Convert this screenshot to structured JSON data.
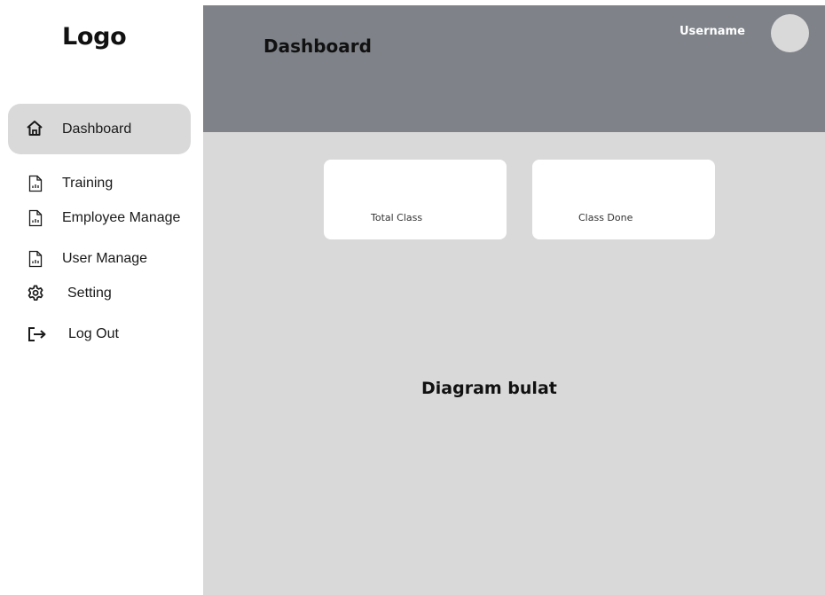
{
  "sidebar": {
    "logo": "Logo",
    "items": [
      {
        "label": "Dashboard",
        "icon": "home-icon",
        "active": true
      },
      {
        "label": "Training",
        "icon": "report-icon",
        "active": false
      },
      {
        "label": "Employee Manage",
        "icon": "report-icon",
        "active": false
      },
      {
        "label": "User Manage",
        "icon": "report-icon",
        "active": false
      },
      {
        "label": "Setting",
        "icon": "gear-icon",
        "active": false
      },
      {
        "label": "Log Out",
        "icon": "logout-icon",
        "active": false
      }
    ]
  },
  "header": {
    "title": "Dashboard",
    "username": "Username"
  },
  "main": {
    "cards": [
      {
        "label": "Total Class"
      },
      {
        "label": "Class Done"
      }
    ],
    "diagram_label": "Diagram bulat"
  },
  "colors": {
    "header_bg": "#7f8389",
    "main_bg": "#d9d9d9",
    "active_item_bg": "#d9d9d9",
    "card_bg": "#ffffff"
  }
}
